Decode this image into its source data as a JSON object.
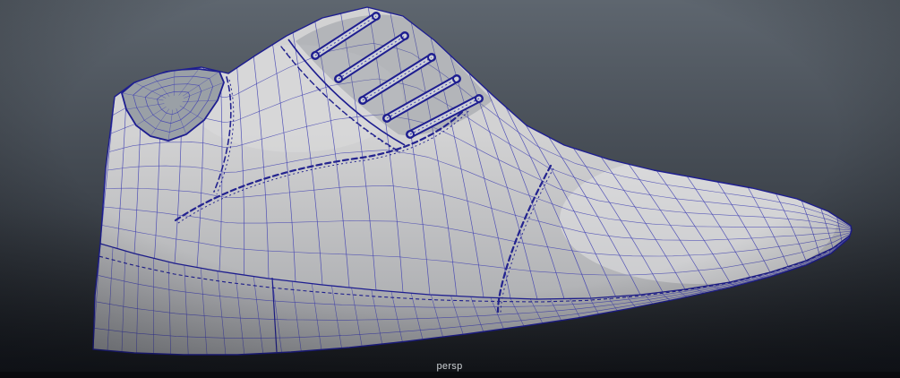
{
  "viewport": {
    "camera_label": "persp",
    "object": "dress-shoe-wireframe-mesh"
  },
  "colors": {
    "bg_top": "#5e666f",
    "bg_mid": "#3d434b",
    "bg_bottom": "#15171b",
    "mesh_fill": "#d2d2d3",
    "mesh_highlight": "#e6e6e7",
    "mesh_shadow": "#7e8187",
    "sole_fill": "#c7c7ca",
    "wire": "#3d3db2",
    "wire_dark": "#1e1e90",
    "seam": "#23238f",
    "collar_inner": "#9aa0a6",
    "lace_fill": "#cdd0d6",
    "label": "#ccd0d4"
  }
}
